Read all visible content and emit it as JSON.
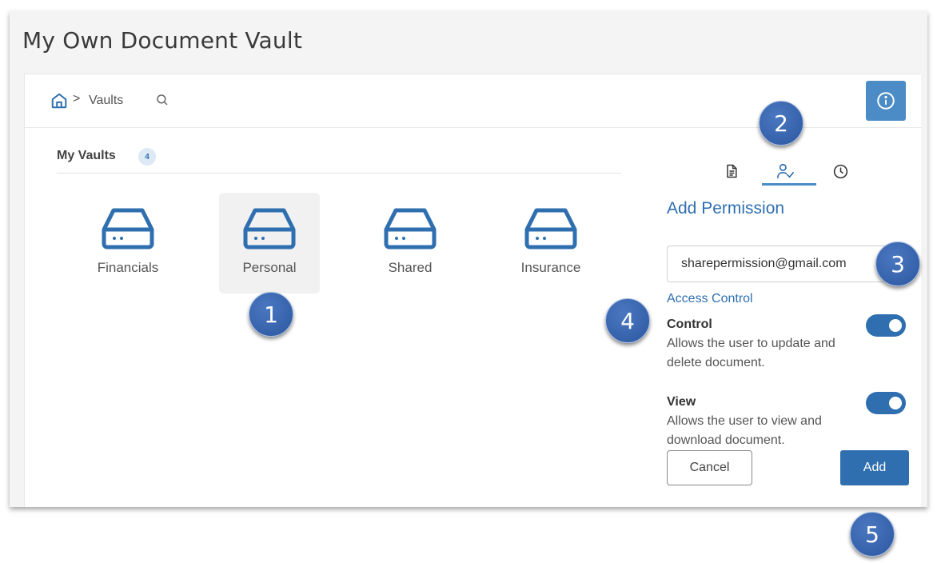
{
  "window": {
    "title": "My Own Document Vault"
  },
  "breadcrumb": {
    "separator": ">",
    "current": "Vaults"
  },
  "vaults": {
    "title": "My Vaults",
    "count": "4",
    "items": [
      {
        "label": "Financials",
        "selected": false
      },
      {
        "label": "Personal",
        "selected": true
      },
      {
        "label": "Shared",
        "selected": false
      },
      {
        "label": "Insurance",
        "selected": false
      }
    ]
  },
  "side_panel": {
    "tabs": [
      {
        "icon": "document-icon",
        "active": false
      },
      {
        "icon": "user-check-icon",
        "active": true
      },
      {
        "icon": "clock-icon",
        "active": false
      }
    ],
    "title": "Add Permission",
    "email_value": "sharepermission@gmail.com",
    "access_control_label": "Access Control",
    "options": [
      {
        "title": "Control",
        "description": "Allows the user to update and delete document.",
        "enabled": true
      },
      {
        "title": "View",
        "description": "Allows the user to view and download document.",
        "enabled": true
      }
    ],
    "cancel_label": "Cancel",
    "add_label": "Add"
  },
  "steps": [
    "1",
    "2",
    "3",
    "4",
    "5"
  ],
  "colors": {
    "accent": "#2f6fb0",
    "info_button": "#4b8cc7",
    "step_badge": "#2c57a0"
  }
}
